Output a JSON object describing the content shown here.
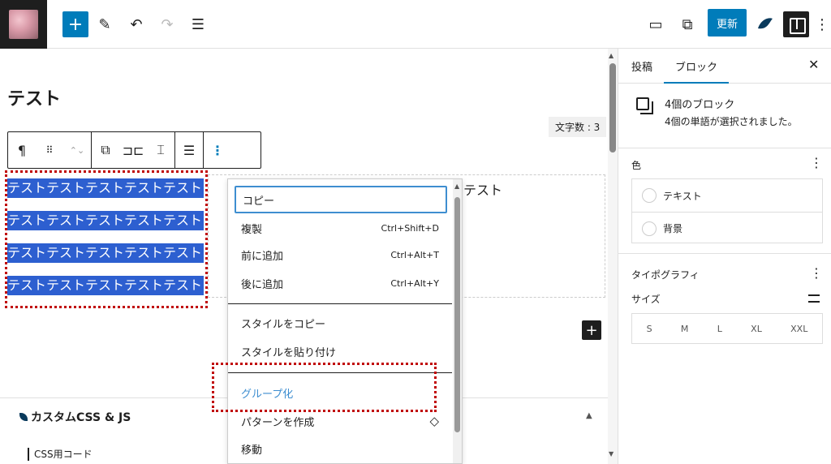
{
  "toolbar": {
    "update_label": "更新"
  },
  "editor": {
    "post_title": "テスト",
    "word_count": "文字数 : 3",
    "lines": [
      "テストテストテストテストテスト",
      "テストテストテストテストテスト",
      "テストテストテストテストテスト",
      "テストテストテストテストテスト"
    ],
    "trailing_text": "テスト",
    "meta_panel_title": "カスタムCSS & JS",
    "meta_sub_label": "CSS用コード"
  },
  "menu": {
    "items": [
      {
        "label": "コピー",
        "shortcut": ""
      },
      {
        "label": "複製",
        "shortcut": "Ctrl+Shift+D"
      },
      {
        "label": "前に追加",
        "shortcut": "Ctrl+Alt+T"
      },
      {
        "label": "後に追加",
        "shortcut": "Ctrl+Alt+Y"
      },
      {
        "label": "スタイルをコピー",
        "shortcut": ""
      },
      {
        "label": "スタイルを貼り付け",
        "shortcut": ""
      },
      {
        "label": "グループ化",
        "shortcut": ""
      },
      {
        "label": "パターンを作成",
        "shortcut": ""
      },
      {
        "label": "移動",
        "shortcut": ""
      }
    ]
  },
  "sidebar": {
    "tabs": [
      "投稿",
      "ブロック"
    ],
    "active_tab": "ブロック",
    "selection_title": "4個のブロック",
    "selection_desc": "4個の単語が選択されました。",
    "color_heading": "色",
    "color_options": [
      "テキスト",
      "背景"
    ],
    "typography_heading": "タイポグラフィ",
    "size_label": "サイズ",
    "sizes": [
      "S",
      "M",
      "L",
      "XL",
      "XXL"
    ]
  },
  "colors": {
    "accent": "#007cba",
    "selection_highlight": "#2d5fd0",
    "annotation_red": "#c00000",
    "menu_focus": "#3e8ed0"
  }
}
